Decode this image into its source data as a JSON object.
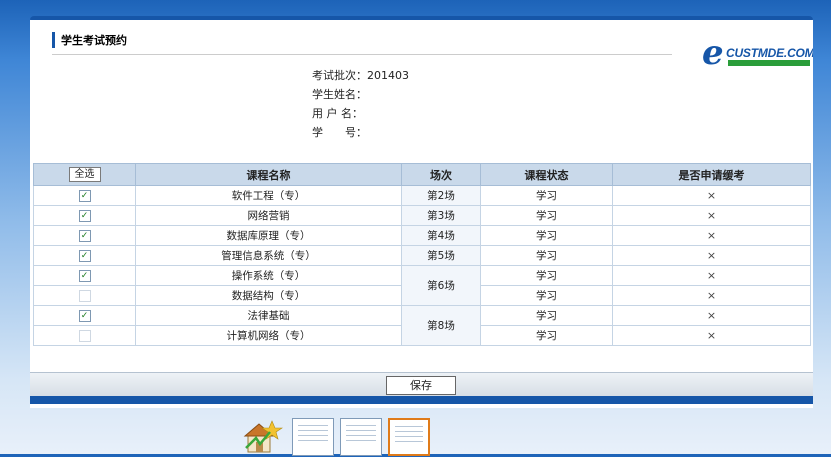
{
  "panel": {
    "title": "学生考试预约"
  },
  "logo": {
    "main": "CUSTMDE.COM"
  },
  "info": {
    "batch_label": "考试批次：",
    "batch_value": "201403",
    "name_label": "学生姓名：",
    "username_label": "用 户 名：",
    "student_id_label": "学　　号："
  },
  "table": {
    "headers": {
      "select_all": "全选",
      "course": "课程名称",
      "session": "场次",
      "status": "课程状态",
      "apply_deferral": "是否申请缓考"
    },
    "rows": [
      {
        "checked": true,
        "course": "软件工程（专）",
        "session": "第2场",
        "status": "学习",
        "apply": "×"
      },
      {
        "checked": true,
        "course": "网络营销",
        "session": "第3场",
        "status": "学习",
        "apply": "×"
      },
      {
        "checked": true,
        "course": "数据库原理（专）",
        "session": "第4场",
        "status": "学习",
        "apply": "×"
      },
      {
        "checked": true,
        "course": "管理信息系统（专）",
        "session": "第5场",
        "status": "学习",
        "apply": "×"
      },
      {
        "checked": true,
        "course": "操作系统（专）",
        "session": "第6场",
        "status": "学习",
        "apply": "×"
      },
      {
        "checked": false,
        "course": "数据结构（专）",
        "session": "",
        "status": "学习",
        "apply": "×"
      },
      {
        "checked": true,
        "course": "法律基础",
        "session": "第8场",
        "status": "学习",
        "apply": "×"
      },
      {
        "checked": false,
        "course": "计算机网络（专）",
        "session": "",
        "status": "学习",
        "apply": "×"
      }
    ]
  },
  "footer": {
    "save_label": "保存"
  },
  "thumbnails": [
    "home-icon",
    "page-thumbnail",
    "page-thumbnail",
    "page-thumbnail-active"
  ],
  "colors": {
    "accent": "#1656a8",
    "header_bg": "#c9d9ea",
    "active_thumb": "#e07b1a"
  }
}
